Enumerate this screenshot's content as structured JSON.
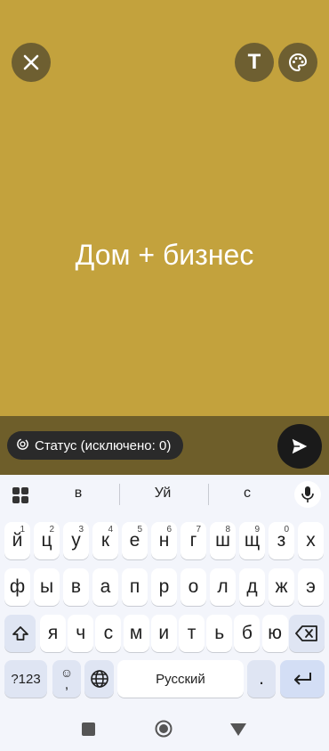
{
  "editor": {
    "status_text": "Дом + бизнес",
    "text_tool_label": "T",
    "background_color": "#c3a23d"
  },
  "bottom": {
    "audience_label": "Статус (исключено: 0)"
  },
  "keyboard": {
    "suggestions": [
      "в",
      "Уй",
      "с"
    ],
    "row1": [
      {
        "k": "й",
        "h": "1"
      },
      {
        "k": "ц",
        "h": "2"
      },
      {
        "k": "у",
        "h": "3"
      },
      {
        "k": "к",
        "h": "4"
      },
      {
        "k": "е",
        "h": "5"
      },
      {
        "k": "н",
        "h": "6"
      },
      {
        "k": "г",
        "h": "7"
      },
      {
        "k": "ш",
        "h": "8"
      },
      {
        "k": "щ",
        "h": "9"
      },
      {
        "k": "з",
        "h": "0"
      },
      {
        "k": "х",
        "h": ""
      }
    ],
    "row2": [
      "ф",
      "ы",
      "в",
      "а",
      "п",
      "р",
      "о",
      "л",
      "д",
      "ж",
      "э"
    ],
    "row3": [
      "я",
      "ч",
      "с",
      "м",
      "и",
      "т",
      "ь",
      "б",
      "ю"
    ],
    "symbols_label": "?123",
    "emoji_top": "☺",
    "emoji_bottom": ",",
    "space_label": "Русский",
    "period_label": "."
  }
}
